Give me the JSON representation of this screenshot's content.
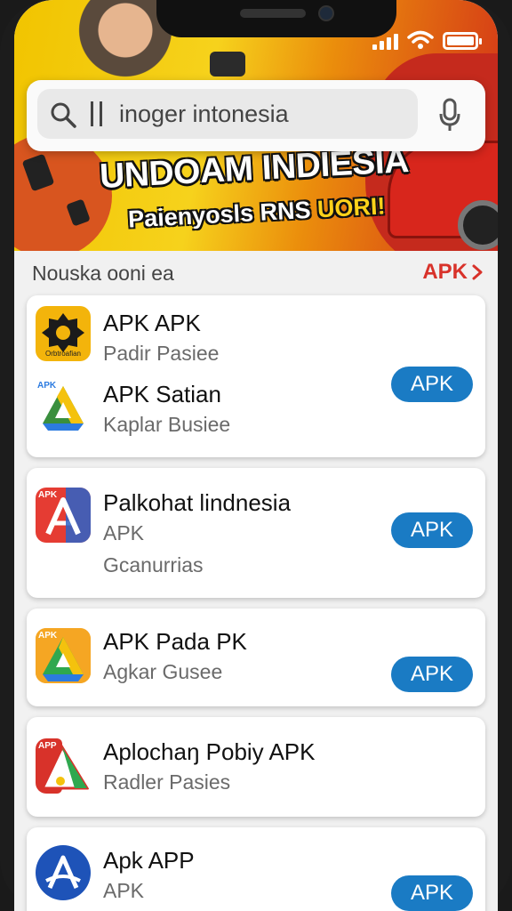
{
  "banner": {
    "title": "UNDOAM INDIESIA",
    "subtitle_white": "Paienyosls RNS ",
    "subtitle_yellow": "UORI!"
  },
  "search": {
    "placeholder": "inoger intonesia"
  },
  "section": {
    "title": "Nouska ooni ea",
    "link_label": "APK",
    "link_color": "#d8322a"
  },
  "cards": [
    {
      "apps": [
        {
          "name": "APK APK",
          "sub": "Padir Pasiee",
          "icon": "badge-icon",
          "icon_text": "Orbtroafian"
        },
        {
          "name": "APK Satian",
          "sub": "Kaplar Busiee",
          "icon": "drive-triangle-icon",
          "icon_text": "APK"
        }
      ],
      "button": "APK"
    },
    {
      "apps": [
        {
          "name": "Palkohat lindnesia",
          "sub": "APK",
          "sub2": "Gcanurrias",
          "icon": "red-a-icon",
          "icon_text": "APK"
        }
      ],
      "button": "APK"
    },
    {
      "apps": [
        {
          "name": "APK Pada PK",
          "sub": "Agkar Gusee",
          "icon": "drive-triangle-icon",
          "icon_text": "APK"
        }
      ],
      "button": "APK"
    },
    {
      "apps": [
        {
          "name": "Aplochaŋ Pobiy APK",
          "sub": "Radler Pasies",
          "icon": "red-triangle-icon",
          "icon_text": "APP"
        }
      ]
    },
    {
      "apps": [
        {
          "name": "Apk APP",
          "sub": "APK",
          "icon": "blue-a-icon"
        }
      ],
      "button": "APK"
    }
  ],
  "colors": {
    "accent_button": "#1a7bc4",
    "link_red": "#d8322a"
  }
}
